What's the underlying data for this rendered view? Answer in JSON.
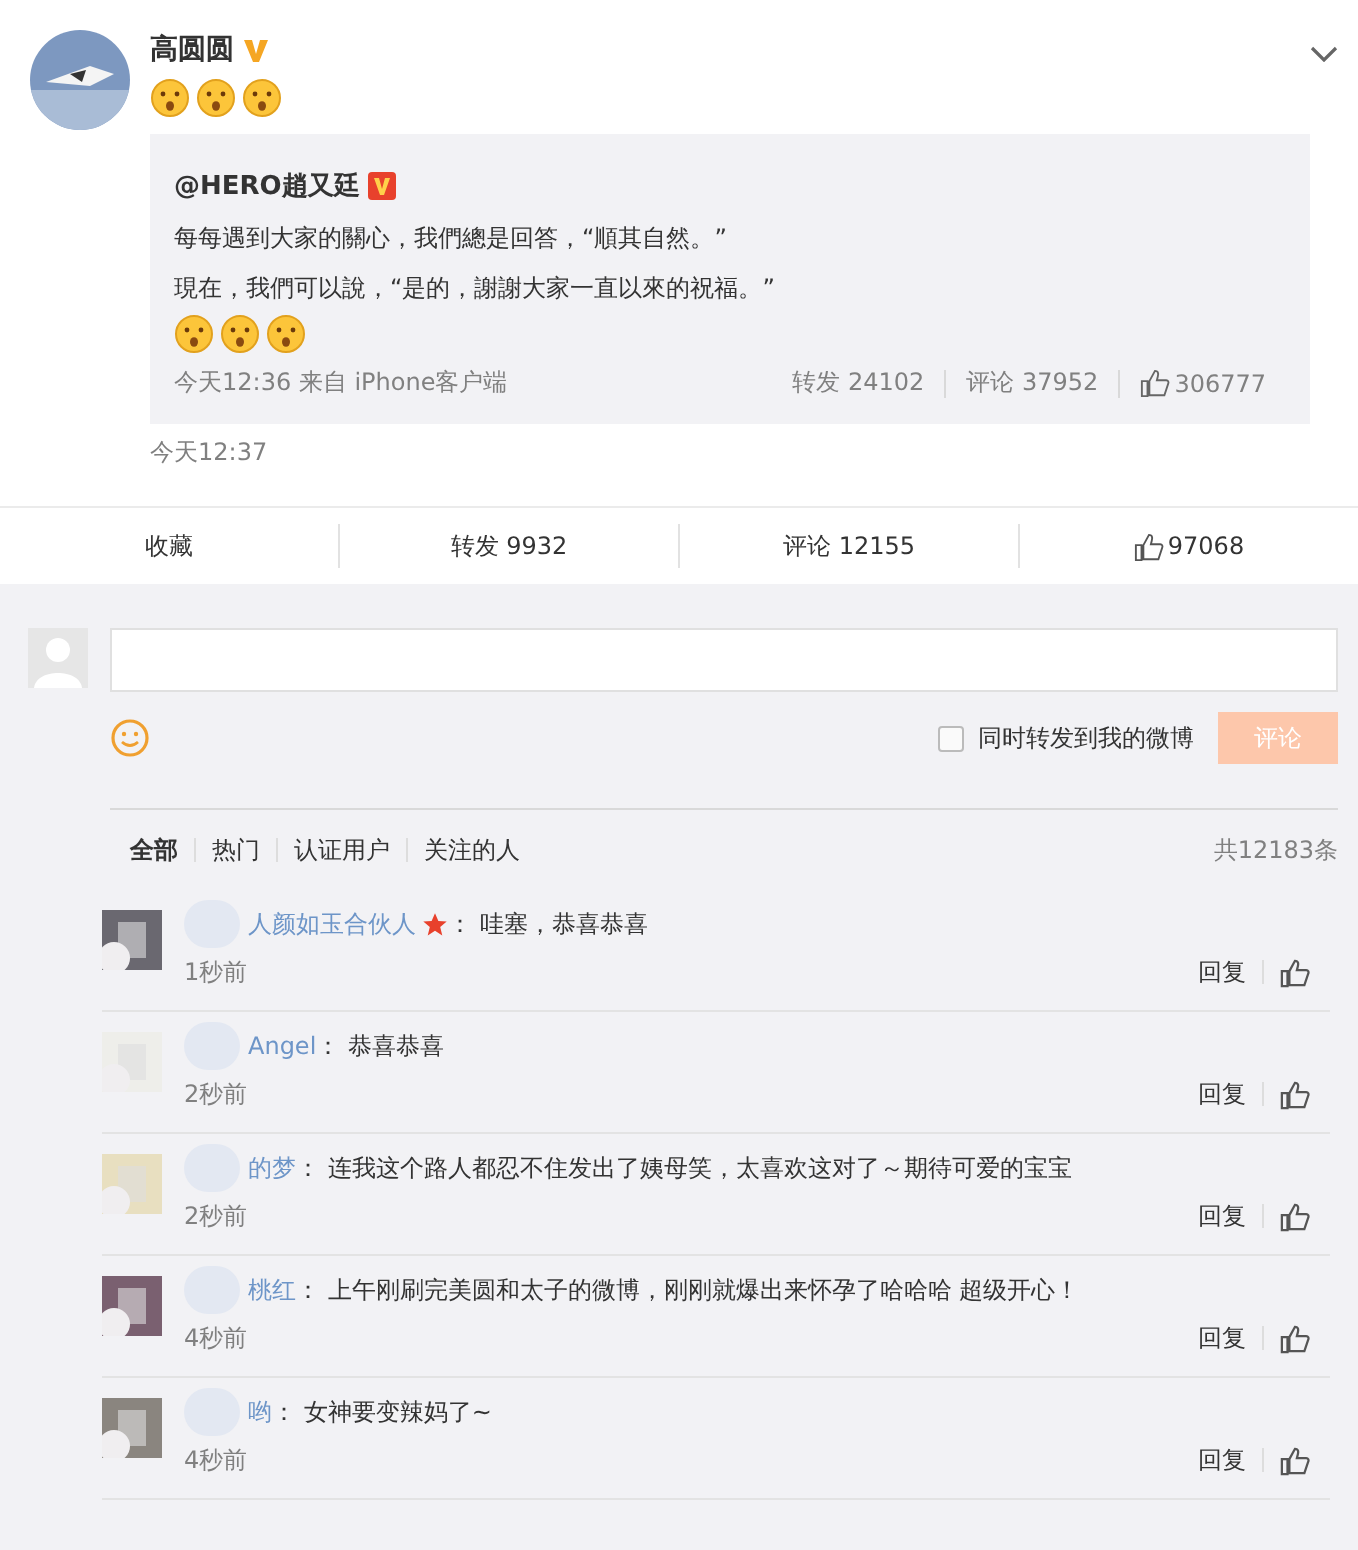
{
  "post": {
    "author": "高圆圆",
    "verified": true,
    "time": "今天12:37",
    "repost": {
      "author": "@HERO趙又廷",
      "verified": true,
      "lines": [
        "每每遇到大家的關心，我們總是回答，“順其自然。”",
        "現在，我們可以說，“是的，謝謝大家一直以來的祝福。”"
      ],
      "meta": "今天12:36 来自 iPhone客户端",
      "reposts": "转发 24102",
      "comments": "评论 37952",
      "likes": "306777"
    }
  },
  "actions": [
    {
      "kind": "text",
      "label": "收藏"
    },
    {
      "kind": "text",
      "label": "转发 9932"
    },
    {
      "kind": "text",
      "label": "评论 12155"
    },
    {
      "kind": "like",
      "label": "97068"
    }
  ],
  "composer": {
    "also_repost": {
      "label": "同时转发到我的微博",
      "checked": false
    },
    "submit": {
      "label": "评论",
      "disabled": true
    }
  },
  "filters": [
    {
      "label": "全部",
      "selected": true
    },
    {
      "label": "热门",
      "selected": false
    },
    {
      "label": "认证用户",
      "selected": false
    },
    {
      "label": "关注的人",
      "selected": false
    }
  ],
  "total": "共12183条",
  "comments": [
    {
      "user": "人颜如玉合伙人",
      "star": true,
      "text": "：  哇塞，恭喜恭喜",
      "time": "1秒前",
      "reply": "回复"
    },
    {
      "user": "Angel",
      "star": false,
      "text": "：  恭喜恭喜",
      "time": "2秒前",
      "reply": "回复"
    },
    {
      "user": "的梦",
      "star": false,
      "text": "：  连我这个路人都忍不住发出了姨母笑，太喜欢这对了～期待可爱的宝宝",
      "time": "2秒前",
      "reply": "回复"
    },
    {
      "user": "桃红",
      "star": false,
      "text": "：  上午刚刷完美圆和太子的微博，刚刚就爆出来怀孕了哈哈哈 超级开心！",
      "time": "4秒前",
      "reply": "回复"
    },
    {
      "user": "哟",
      "star": false,
      "text": "：  女神要变辣妈了~",
      "time": "4秒前",
      "reply": "回复"
    }
  ]
}
